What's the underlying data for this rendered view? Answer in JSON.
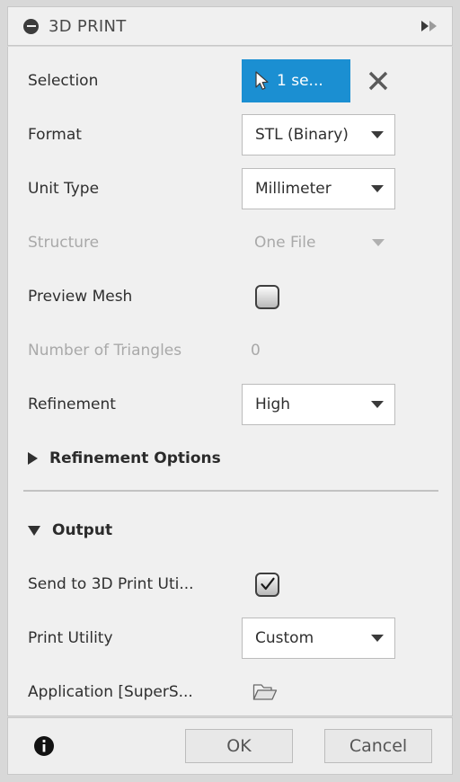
{
  "window": {
    "title": "3D PRINT",
    "collapse_icon": "minus-circle-icon",
    "expand_icon": "fast-forward-icon"
  },
  "rows": {
    "selection": {
      "label": "Selection",
      "button_text": "1 se...",
      "button_color": "#1b8fd2",
      "cursor_icon": "cursor-arrow-icon",
      "clear_icon": "close-x-icon"
    },
    "format": {
      "label": "Format",
      "value": "STL (Binary)",
      "enabled": true
    },
    "unit_type": {
      "label": "Unit Type",
      "value": "Millimeter",
      "enabled": true
    },
    "structure": {
      "label": "Structure",
      "value": "One File",
      "enabled": false
    },
    "preview_mesh": {
      "label": "Preview Mesh",
      "checked": false
    },
    "number_of_triangles": {
      "label": "Number of Triangles",
      "value": "0",
      "enabled": false
    },
    "refinement": {
      "label": "Refinement",
      "value": "High",
      "enabled": true
    }
  },
  "sections": {
    "refinement_options": {
      "label": "Refinement Options",
      "expanded": false,
      "icon": "triangle-right-icon"
    },
    "output": {
      "label": "Output",
      "expanded": true,
      "icon": "triangle-down-icon"
    }
  },
  "output": {
    "send_to_utility": {
      "label": "Send to 3D Print Uti...",
      "checked": true
    },
    "print_utility": {
      "label": "Print Utility",
      "value": "Custom"
    },
    "application": {
      "label": "Application [SuperS...",
      "browse_icon": "folder-open-icon"
    }
  },
  "footer": {
    "info_icon": "info-icon",
    "ok_label": "OK",
    "cancel_label": "Cancel"
  },
  "colors": {
    "accent": "#1b8fd2",
    "panel_bg": "#f0f0f0",
    "window_bg": "#d8d8d8",
    "text": "#2f2f2f",
    "disabled_text": "#a9a9a9"
  }
}
